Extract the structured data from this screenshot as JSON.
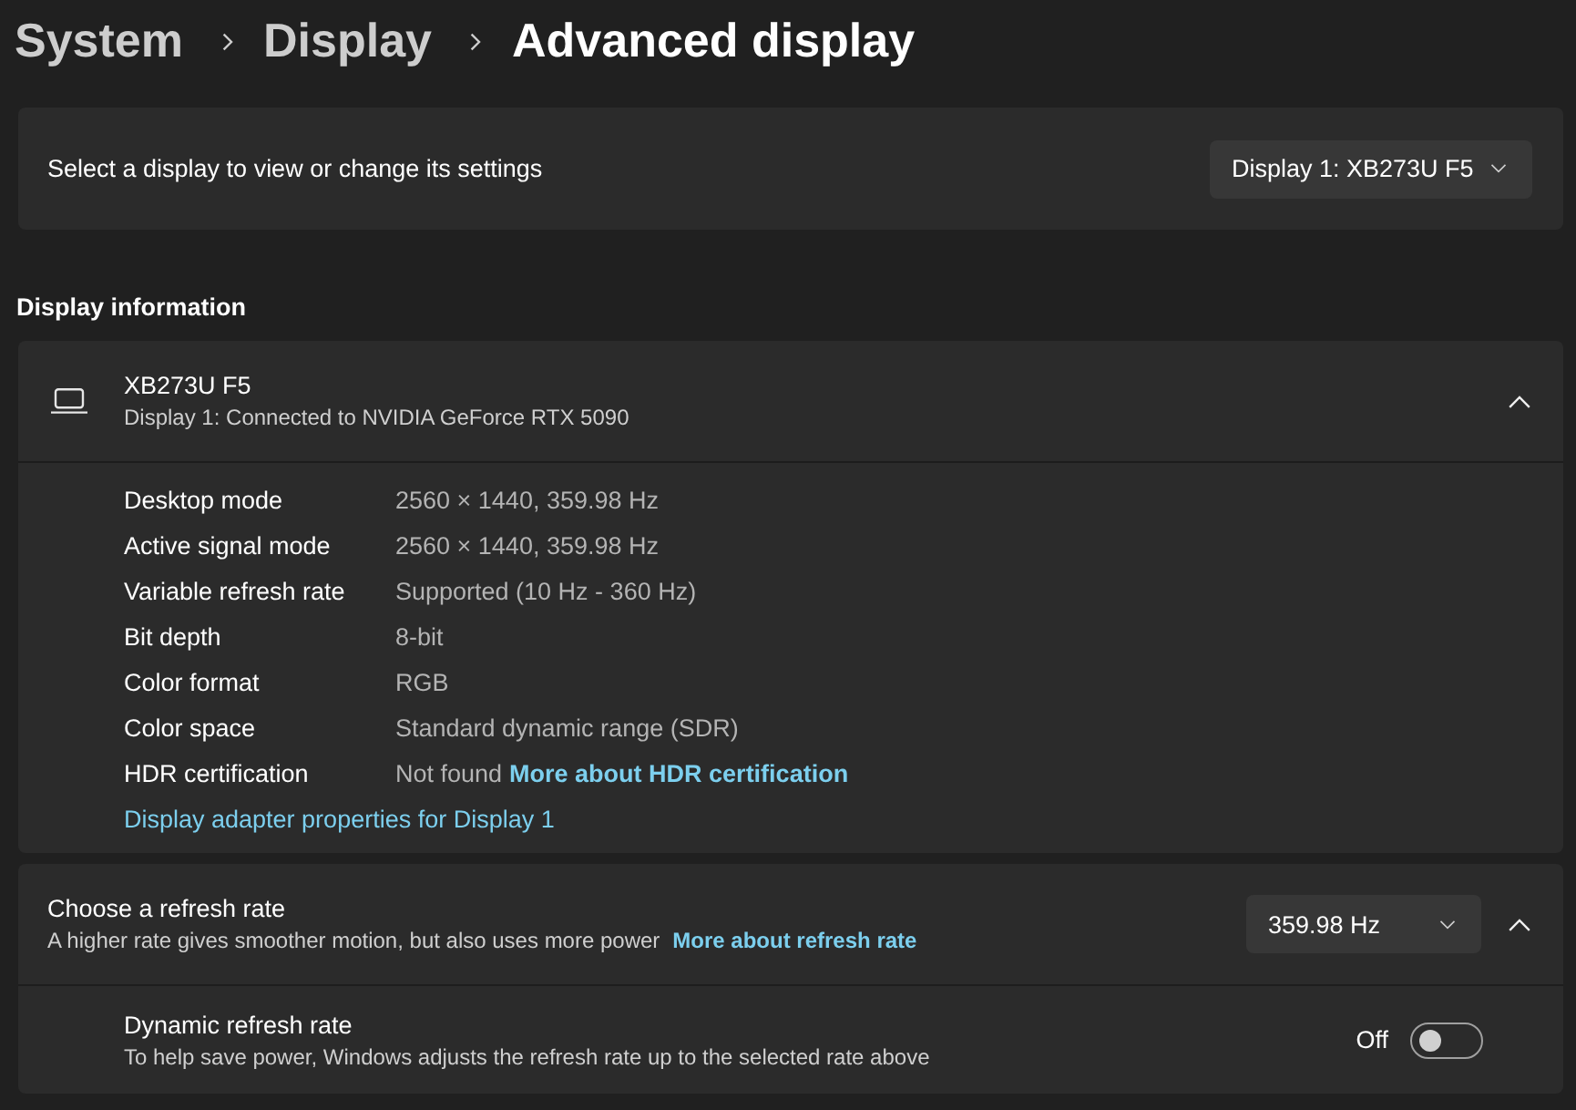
{
  "breadcrumb": [
    {
      "label": "System",
      "current": false
    },
    {
      "label": "Display",
      "current": false
    },
    {
      "label": "Advanced display",
      "current": true
    }
  ],
  "display_selector": {
    "label": "Select a display to view or change its settings",
    "value": "Display 1: XB273U F5"
  },
  "section_title": "Display information",
  "display_info": {
    "name": "XB273U F5",
    "subtitle": "Display 1: Connected to NVIDIA GeForce RTX 5090",
    "expanded": true,
    "rows": [
      {
        "label": "Desktop mode",
        "value": "2560 × 1440, 359.98 Hz"
      },
      {
        "label": "Active signal mode",
        "value": "2560 × 1440, 359.98 Hz"
      },
      {
        "label": "Variable refresh rate",
        "value": "Supported (10 Hz - 360 Hz)"
      },
      {
        "label": "Bit depth",
        "value": "8-bit"
      },
      {
        "label": "Color format",
        "value": "RGB"
      },
      {
        "label": "Color space",
        "value": "Standard dynamic range (SDR)"
      },
      {
        "label": "HDR certification",
        "value": "Not found",
        "link": "More about HDR certification"
      }
    ],
    "link": "Display adapter properties for Display 1"
  },
  "refresh_rate": {
    "title": "Choose a refresh rate",
    "description": "A higher rate gives smoother motion, but also uses more power",
    "link": "More about refresh rate",
    "value": "359.98 Hz",
    "expanded": true,
    "dynamic": {
      "title": "Dynamic refresh rate",
      "description": "To help save power, Windows adjusts the refresh rate up to the selected rate above",
      "state_label": "Off",
      "on": false
    }
  }
}
